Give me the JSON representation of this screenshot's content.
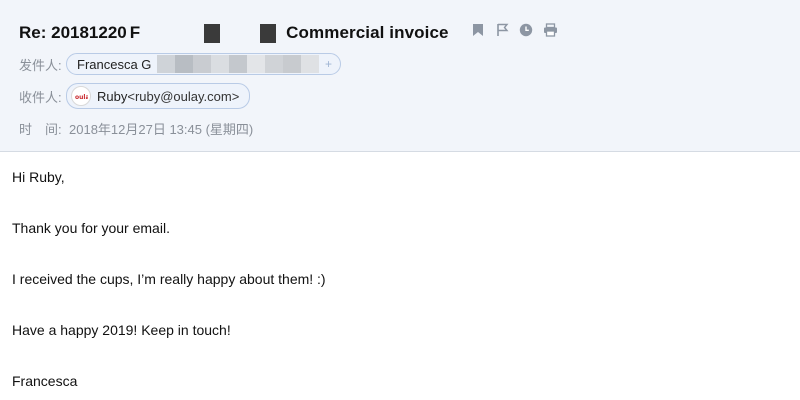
{
  "subject": {
    "prefix": "Re: 20181220",
    "fragment": "F",
    "title": "Commercial invoice"
  },
  "icons": [
    "bookmark-icon",
    "flag-icon",
    "clock-icon",
    "print-icon"
  ],
  "from": {
    "label": "发件人:",
    "name": "Francesca G",
    "plus": "+"
  },
  "to": {
    "label": "收件人:",
    "name": "Ruby",
    "email": "<ruby@oulay.com>"
  },
  "time": {
    "label": "时　间:",
    "value": "2018年12月27日 13:45 (星期四)"
  },
  "body": {
    "lines": [
      "Hi Ruby,",
      "Thank you for your email.",
      "I received the cups, I’m really happy about them! :)",
      "Have a happy 2019! Keep in touch!",
      "Francesca"
    ]
  },
  "colors": {
    "header_bg": "#f2f5fa",
    "chip_bg": "#eef3fb",
    "chip_border": "#b9cbe6",
    "label": "#8a9099"
  }
}
